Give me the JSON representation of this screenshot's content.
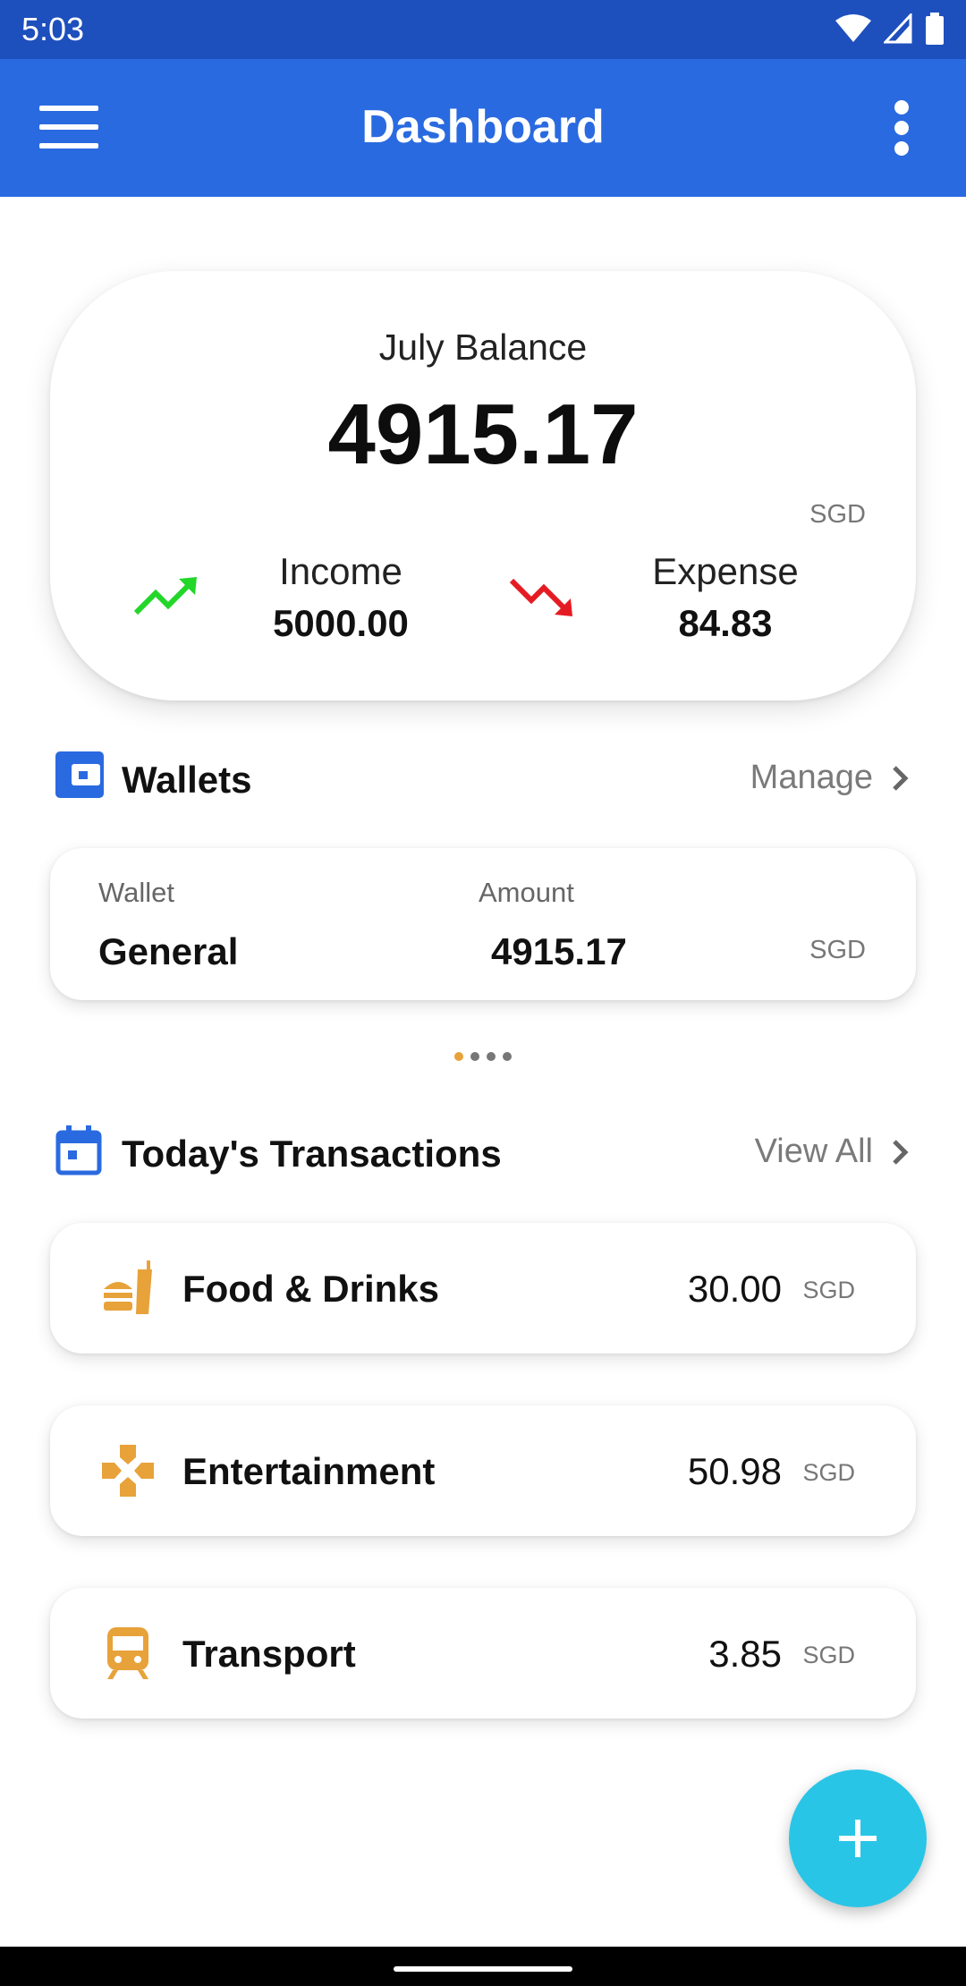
{
  "status_bar": {
    "time": "5:03"
  },
  "app_bar": {
    "title": "Dashboard"
  },
  "balance": {
    "label": "July Balance",
    "amount": "4915.17",
    "currency": "SGD",
    "income_label": "Income",
    "income_value": "5000.00",
    "expense_label": "Expense",
    "expense_value": "84.83"
  },
  "wallets": {
    "title": "Wallets",
    "manage_label": "Manage",
    "wallet_col_label": "Wallet",
    "amount_col_label": "Amount",
    "name": "General",
    "amount": "4915.17",
    "currency": "SGD"
  },
  "transactions": {
    "title": "Today's Transactions",
    "view_all_label": "View All",
    "items": [
      {
        "name": "Food & Drinks",
        "amount": "30.00",
        "currency": "SGD",
        "icon": "food-drinks-icon"
      },
      {
        "name": "Entertainment",
        "amount": "50.98",
        "currency": "SGD",
        "icon": "gamepad-icon"
      },
      {
        "name": "Transport",
        "amount": "3.85",
        "currency": "SGD",
        "icon": "train-icon"
      }
    ]
  },
  "colors": {
    "status_bar": "#1d4fbd",
    "app_bar": "#2a6ae0",
    "income_trend": "#22d62a",
    "expense_trend": "#e51b23",
    "category_icon": "#e8a23a",
    "fab": "#29c5e6"
  }
}
